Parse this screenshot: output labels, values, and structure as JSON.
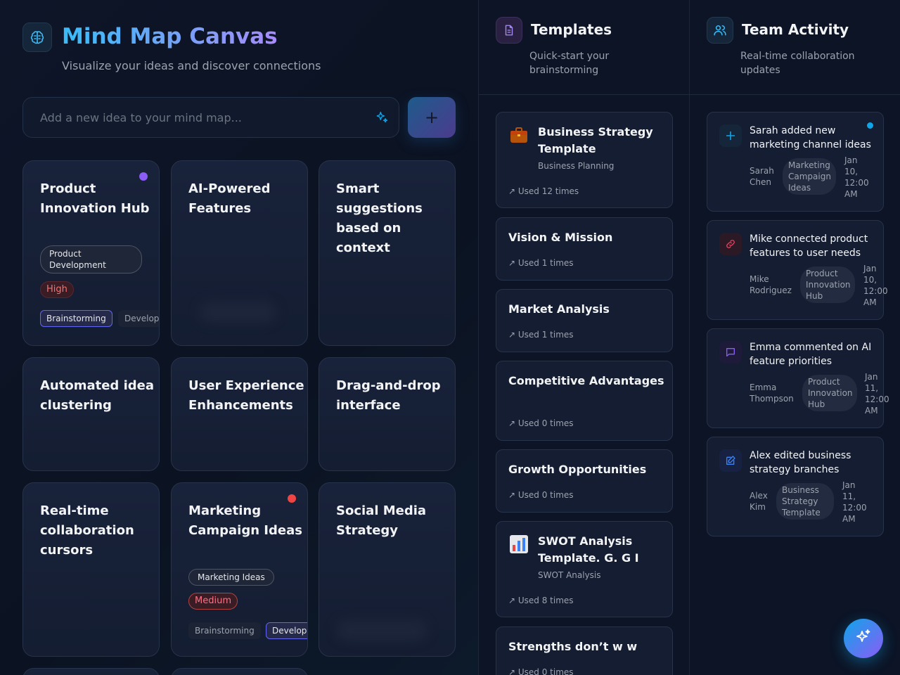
{
  "app": {
    "title": "Mind Map Canvas",
    "subtitle": "Visualize your ideas and discover connections"
  },
  "idea_input": {
    "placeholder": "Add a new idea to your mind map...",
    "add_label": "+"
  },
  "cards": [
    {
      "title": "Product Innovation Hub",
      "category": "Product Development",
      "priority": "High",
      "stages": [
        "Brainstorming",
        "Developing"
      ],
      "active_stage": "Brainstorming",
      "dot_color": "#8b5cf6"
    },
    {
      "title": "AI-Powered Features"
    },
    {
      "title": "Smart suggestions based on context"
    },
    {
      "title": "Automated idea clustering"
    },
    {
      "title": "User Experience Enhancements"
    },
    {
      "title": "Drag-and-drop interface"
    },
    {
      "title": "Real-time collaboration cursors"
    },
    {
      "title": "Marketing Campaign Ideas",
      "category": "Marketing Ideas",
      "priority": "Medium",
      "stages": [
        "Brainstorming",
        "Developing"
      ],
      "active_stage": "Developing",
      "dot_color": "#ef4444"
    },
    {
      "title": "Social Media Strategy"
    }
  ],
  "templates": {
    "title": "Templates",
    "subtitle": "Quick-start your brainstorming",
    "items": [
      {
        "title": "Business Strategy Template",
        "category": "Business Planning",
        "used": "Used 12 times",
        "icon": "briefcase-icon"
      },
      {
        "title": "Vision & Mission",
        "used": "Used 1 times"
      },
      {
        "title": "Market Analysis",
        "used": "Used 1 times"
      },
      {
        "title": "Competitive Advantages",
        "used": "Used 0 times"
      },
      {
        "title": "Growth Opportunities",
        "used": "Used 0 times"
      },
      {
        "title": "SWOT Analysis Template. G. G I",
        "category": "SWOT Analysis",
        "used": "Used 8 times",
        "icon": "bar-chart-icon"
      },
      {
        "title": "Strengths don’t w w",
        "used": "Used 0 times"
      }
    ]
  },
  "activity": {
    "title": "Team Activity",
    "subtitle": "Real-time collaboration updates",
    "items": [
      {
        "text": "Sarah added new marketing channel ideas",
        "user": "Sarah Chen",
        "ref": "Marketing Campaign Ideas",
        "date": "Jan 10, 12:00 AM",
        "icon": "plus-icon",
        "color": "#0ea5e9"
      },
      {
        "text": "Mike connected product features to user needs",
        "user": "Mike Rodriguez",
        "ref": "Product Innovation Hub",
        "date": "Jan 10, 12:00 AM",
        "icon": "link-icon",
        "color": "#f43f5e"
      },
      {
        "text": "Emma commented on AI feature priorities",
        "user": "Emma Thompson",
        "ref": "Product Innovation Hub",
        "date": "Jan 11, 12:00 AM",
        "icon": "comment-icon",
        "color": "#8b5cf6"
      },
      {
        "text": "Alex edited business strategy branches",
        "user": "Alex Kim",
        "ref": "Business Strategy Template",
        "date": "Jan 11, 12:00 AM",
        "icon": "edit-icon",
        "color": "#3b82f6"
      }
    ]
  }
}
